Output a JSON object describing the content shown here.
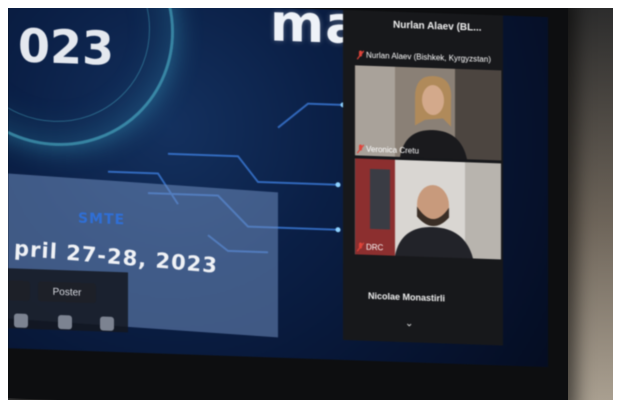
{
  "slide": {
    "title_left": "",
    "title_right": "mance",
    "year": "023",
    "organizer": "SMTE",
    "event_date": "pril 27-28, 2023"
  },
  "taskbar": {
    "buttons": [
      "",
      "Poster"
    ]
  },
  "zoom": {
    "top_name": "Nurlan Alaev (BL...",
    "speaker_label": "Nurlan Alaev (Bishkek, Kyrgyzstan)",
    "tiles": [
      {
        "name": "Veronica Cretu"
      },
      {
        "name": "DRC"
      }
    ],
    "bottom_name": "Nicolae Monastirli",
    "chevron_icon": "chevron-down-icon"
  },
  "colors": {
    "screen_bg": "#0b2047",
    "accent_cyan": "#5ad2e6",
    "org_blue": "#2f6fd6",
    "mic_off_red": "#e0443a"
  }
}
